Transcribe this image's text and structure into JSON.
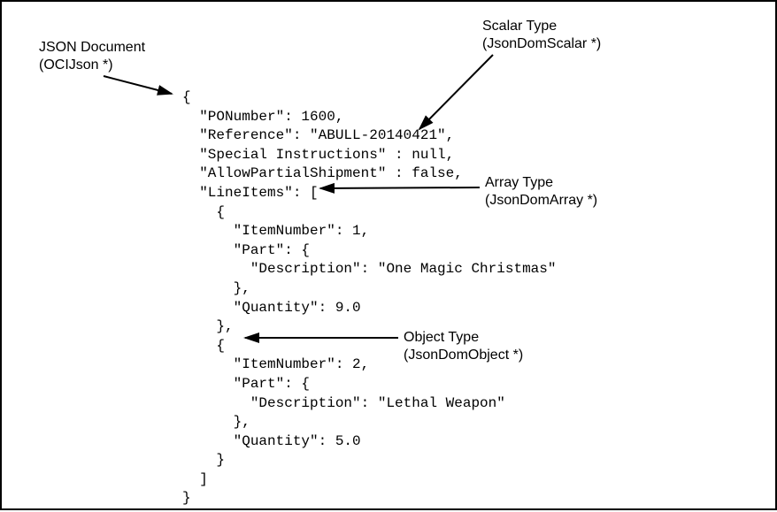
{
  "labels": {
    "json_doc": "JSON Document\n(OCIJson *)",
    "scalar_type": "Scalar Type\n(JsonDomScalar *)",
    "array_type": "Array Type\n(JsonDomArray *)",
    "object_type": "Object Type\n(JsonDomObject *)"
  },
  "code_lines": [
    "{",
    "  \"PONumber\": 1600,",
    "  \"Reference\": \"ABULL-20140421\",",
    "  \"Special Instructions\" : null,",
    "  \"AllowPartialShipment\" : false,",
    "  \"LineItems\": [",
    "    {",
    "      \"ItemNumber\": 1,",
    "      \"Part\": {",
    "        \"Description\": \"One Magic Christmas\"",
    "      },",
    "      \"Quantity\": 9.0",
    "    },",
    "    {",
    "      \"ItemNumber\": 2,",
    "      \"Part\": {",
    "        \"Description\": \"Lethal Weapon\"",
    "      },",
    "      \"Quantity\": 5.0",
    "    }",
    "  ]",
    "}"
  ],
  "json_document": {
    "PONumber": 1600,
    "Reference": "ABULL-20140421",
    "Special Instructions": null,
    "AllowPartialShipment": false,
    "LineItems": [
      {
        "ItemNumber": 1,
        "Part": {
          "Description": "One Magic Christmas"
        },
        "Quantity": 9.0
      },
      {
        "ItemNumber": 2,
        "Part": {
          "Description": "Lethal Weapon"
        },
        "Quantity": 5.0
      }
    ]
  }
}
